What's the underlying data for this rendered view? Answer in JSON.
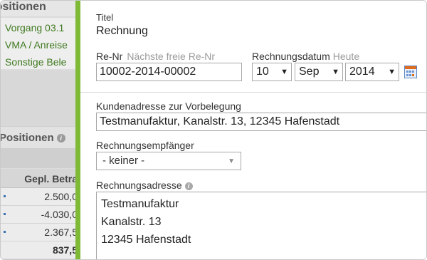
{
  "background": {
    "title": "Positionen",
    "links": [
      "Vorgang 03.1",
      "VMA / Anreise",
      "Sonstige Bele"
    ],
    "section_title": "Positionen",
    "column_header": "Gepl. Betra",
    "rows": [
      "2.500,0",
      "-4.030,0",
      "2.367,5"
    ],
    "total": "837,5"
  },
  "dialog": {
    "titel_label": "Titel",
    "titel_value": "Rechnung",
    "renr_label": "Re-Nr",
    "renr_hint": "Nächste freie Re-Nr",
    "renr_value": "10002-2014-00002",
    "datum_label": "Rechnungsdatum",
    "datum_hint": "Heute",
    "day": "10",
    "month": "Sep",
    "year": "2014",
    "kunden_label": "Kundenadresse zur Vorbelegung",
    "kunden_value": "Testmanufaktur, Kanalstr. 13, 12345 Hafenstadt",
    "empfaenger_label": "Rechnungsempfänger",
    "empfaenger_value": "- keiner -",
    "adresse_label": "Rechnungsadresse",
    "adresse_lines": [
      "Testmanufaktur",
      "Kanalstr. 13",
      "12345 Hafenstadt"
    ]
  },
  "colors": {
    "accent_green": "#7fba37",
    "link_green": "#3f7a1f",
    "calendar_orange": "#e26b1a",
    "calendar_blue": "#5b86c3"
  },
  "icons": [
    "info-icon",
    "calendar-icon",
    "dropdown-arrow-icon"
  ]
}
